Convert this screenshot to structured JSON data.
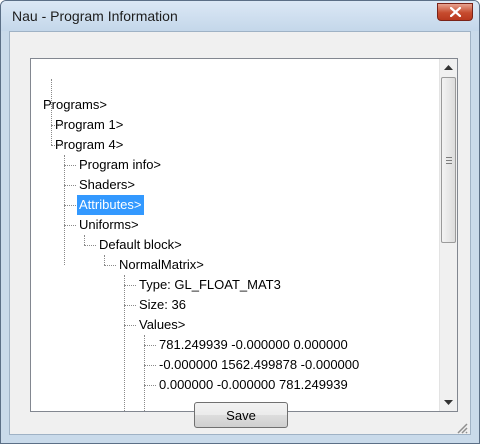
{
  "window": {
    "title": "Nau - Program Information"
  },
  "tree": {
    "nodes": [
      {
        "id": "programs",
        "label": "Programs>"
      },
      {
        "id": "program1",
        "label": "Program 1>"
      },
      {
        "id": "program4",
        "label": "Program 4>"
      },
      {
        "id": "program_info",
        "label": "Program info>"
      },
      {
        "id": "shaders",
        "label": "Shaders>"
      },
      {
        "id": "attributes",
        "label": "Attributes>",
        "selected": true
      },
      {
        "id": "uniforms",
        "label": "Uniforms>"
      },
      {
        "id": "default_block",
        "label": "Default block>"
      },
      {
        "id": "normal_matrix",
        "label": "NormalMatrix>"
      },
      {
        "id": "type",
        "label": "Type: GL_FLOAT_MAT3"
      },
      {
        "id": "size",
        "label": "Size: 36"
      },
      {
        "id": "values",
        "label": "Values>"
      },
      {
        "id": "row1",
        "label": "781.249939 -0.000000 0.000000"
      },
      {
        "id": "row2",
        "label": "-0.000000 1562.499878 -0.000000"
      },
      {
        "id": "row3",
        "label": "0.000000 -0.000000 781.249939"
      }
    ]
  },
  "buttons": {
    "save_label": "Save"
  },
  "colors": {
    "selection": "#3399ff",
    "close_button": "#c64b2e"
  },
  "icons": {
    "close": "close-icon",
    "scroll_up": "chevron-up-icon",
    "scroll_down": "chevron-down-icon",
    "resize": "resize-grip-icon"
  }
}
